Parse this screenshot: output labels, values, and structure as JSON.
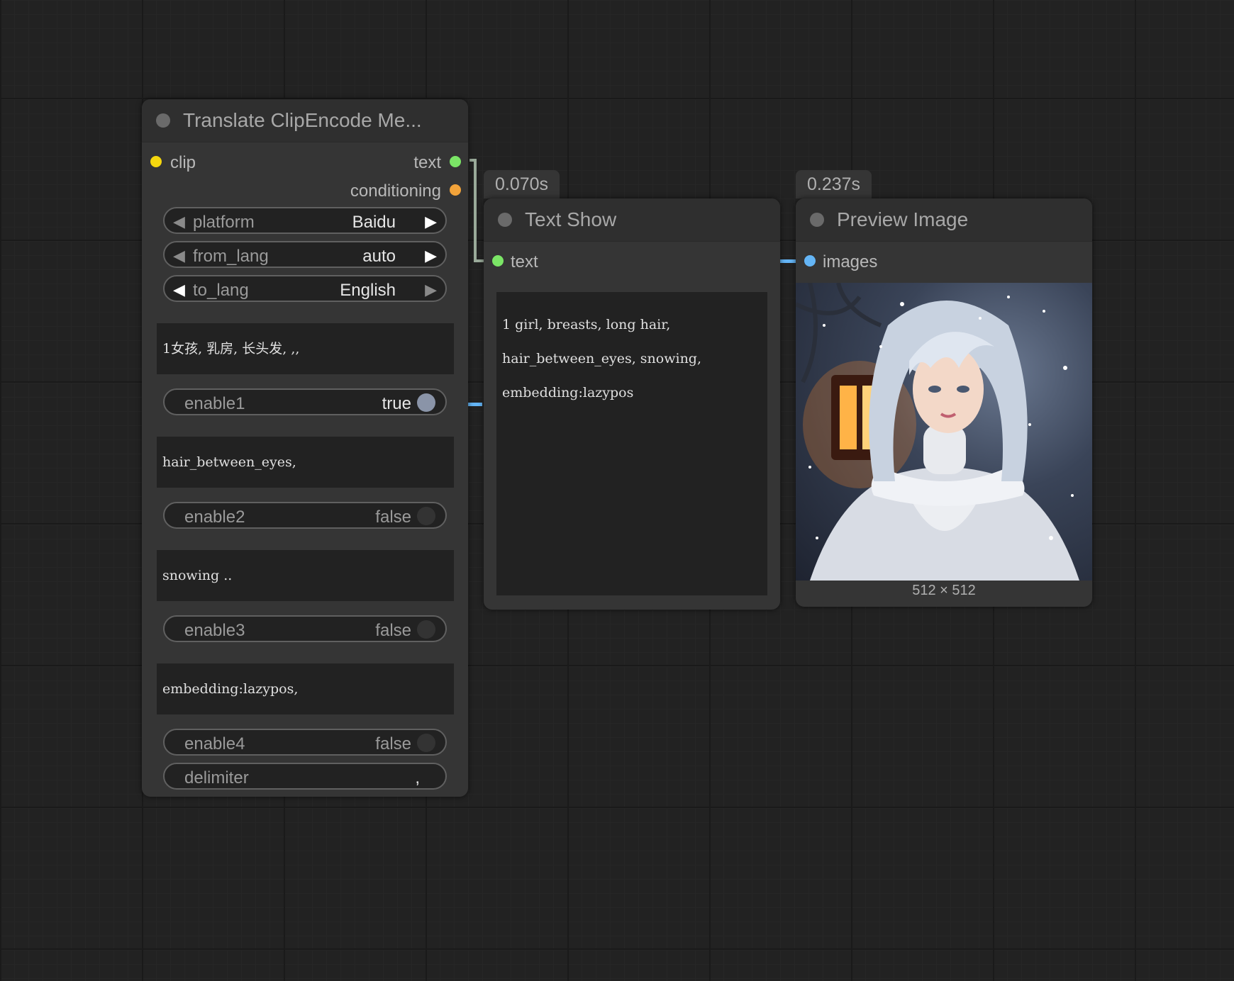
{
  "translate_node": {
    "title": "Translate ClipEncode Me...",
    "inputs": [
      {
        "label": "clip",
        "color": "#f5d70e"
      }
    ],
    "outputs": [
      {
        "label": "text",
        "color": "#7be566"
      },
      {
        "label": "conditioning",
        "color": "#f2a33a"
      }
    ],
    "combos": [
      {
        "label": "platform",
        "value": "Baidu"
      },
      {
        "label": "from_lang",
        "value": "auto"
      },
      {
        "label": "to_lang",
        "value": "English"
      }
    ],
    "text1": "1女孩, 乳房, 长头发, ,,",
    "enable1": {
      "label": "enable1",
      "value": "true"
    },
    "text2": "hair_between_eyes,",
    "enable2": {
      "label": "enable2",
      "value": "false"
    },
    "text3": "snowing ..",
    "enable3": {
      "label": "enable3",
      "value": "false"
    },
    "text4": "embedding:lazypos,",
    "enable4": {
      "label": "enable4",
      "value": "false"
    },
    "delimiter": {
      "label": "delimiter",
      "value": ","
    }
  },
  "text_show_node": {
    "timing": "0.070s",
    "title": "Text Show",
    "input_label": "text",
    "input_color": "#7be566",
    "lines": [
      "1 girl, breasts, long hair,",
      "hair_between_eyes, snowing,",
      "embedding:lazypos"
    ]
  },
  "preview_node": {
    "timing": "0.237s",
    "title": "Preview Image",
    "input_label": "images",
    "input_color": "#64b5f6",
    "image_caption": "512 × 512"
  },
  "colors": {
    "canvas": "#222222",
    "node_body": "#353535",
    "node_title": "#2f2f2f",
    "wire_text": "#8a9a8a",
    "wire_image": "#64b5f6"
  }
}
